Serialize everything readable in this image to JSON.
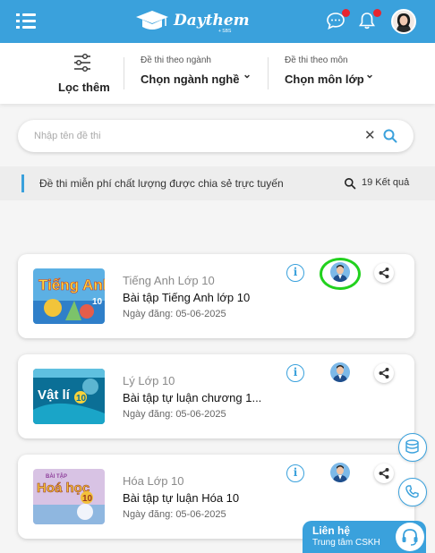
{
  "header": {
    "logo_text": "Daythem",
    "logo_sub": "+ SBS",
    "colors": {
      "brand": "#3aa1dc",
      "badge": "#e8252f"
    },
    "icons": [
      "menu-icon",
      "chat-icon",
      "bell-icon",
      "user-avatar"
    ]
  },
  "filters": {
    "filter_label": "Lọc thêm",
    "major": {
      "caption": "Đề thi theo ngành",
      "value": "Chọn ngành nghề"
    },
    "subject": {
      "caption": "Đề thi theo môn",
      "value": "Chọn môn lớp"
    }
  },
  "search": {
    "placeholder": "Nhập tên đề thi",
    "value": ""
  },
  "info_strip": {
    "text": "Đề thi miễn phí chất lượng được chia sẻ trực tuyến",
    "count": "19 Kết quả"
  },
  "cards": [
    {
      "subject": "Tiếng Anh Lớp 10",
      "title": "Bài tập Tiếng Anh lớp 10",
      "date": "Ngày đăng: 05-06-2025",
      "cover_text": "Tiếng Anh",
      "cover_num": "10",
      "cover_color": "#2f7fc9"
    },
    {
      "subject": "Lý Lớp 10",
      "title": "Bài tập tự luận chương 1...",
      "date": "Ngày đăng: 05-06-2025",
      "cover_text": "Vật lí",
      "cover_num": "10",
      "cover_color": "#1c8fb6"
    },
    {
      "subject": "Hóa Lớp 10",
      "title": "Bài tập tự luận Hóa 10",
      "date": "Ngày đăng: 05-06-2025",
      "cover_text": "Hoá học",
      "cover_num": "10",
      "cover_color": "#c7a8d6"
    }
  ],
  "cover_top_label": "BÀI TẬP",
  "info_glyph": "i",
  "contact": {
    "title": "Liên hệ",
    "subtitle": "Trung tâm CSKH"
  }
}
